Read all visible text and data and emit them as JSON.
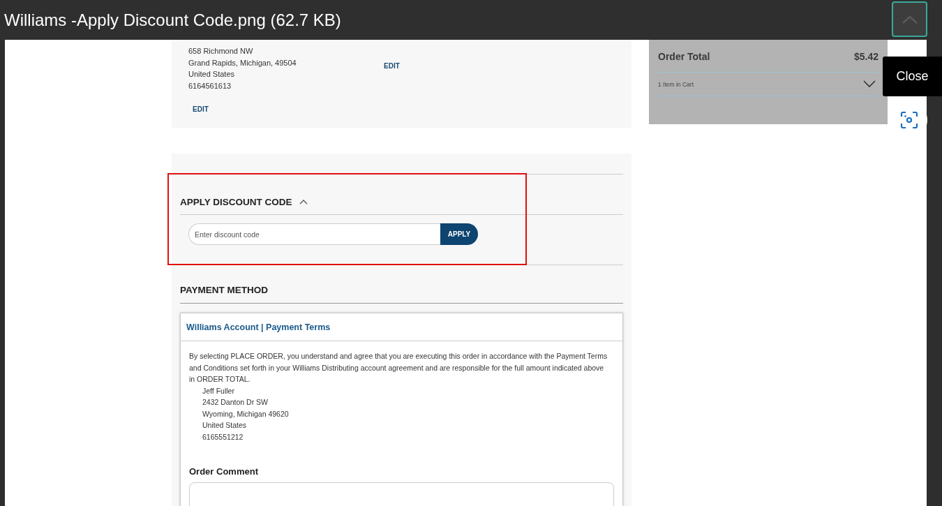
{
  "viewer": {
    "title": "Williams -Apply Discount Code.png (62.7 KB)",
    "close_tooltip": "Close"
  },
  "shipping_card": {
    "address_lines": [
      "658 Richmond NW",
      "Grand Rapids, Michigan, 49504",
      "United States",
      "6164561613"
    ],
    "edit_links": [
      "EDIT",
      "EDIT"
    ]
  },
  "discount": {
    "heading": "APPLY DISCOUNT CODE",
    "expanded": true,
    "placeholder": "Enter discount code",
    "button": "APPLY"
  },
  "payment": {
    "heading": "PAYMENT METHOD",
    "option_title": "Williams Account | Payment Terms",
    "terms": "By selecting PLACE ORDER, you understand and agree that you are executing this order in accordance with the Payment Terms and Conditions set forth in your Williams Distributing account agreement and are responsible for the full amount indicated above in ORDER TOTAL.",
    "address_lines": [
      "Jeff Fuller",
      "2432 Danton Dr SW",
      "Wyoming, Michigan 49620",
      "United States",
      "6165551212"
    ],
    "comment_label": "Order Comment"
  },
  "summary": {
    "total_label": "Order Total",
    "total_value": "$5.42",
    "cart_label": "1 Item in Cart",
    "cart_expanded": false
  }
}
